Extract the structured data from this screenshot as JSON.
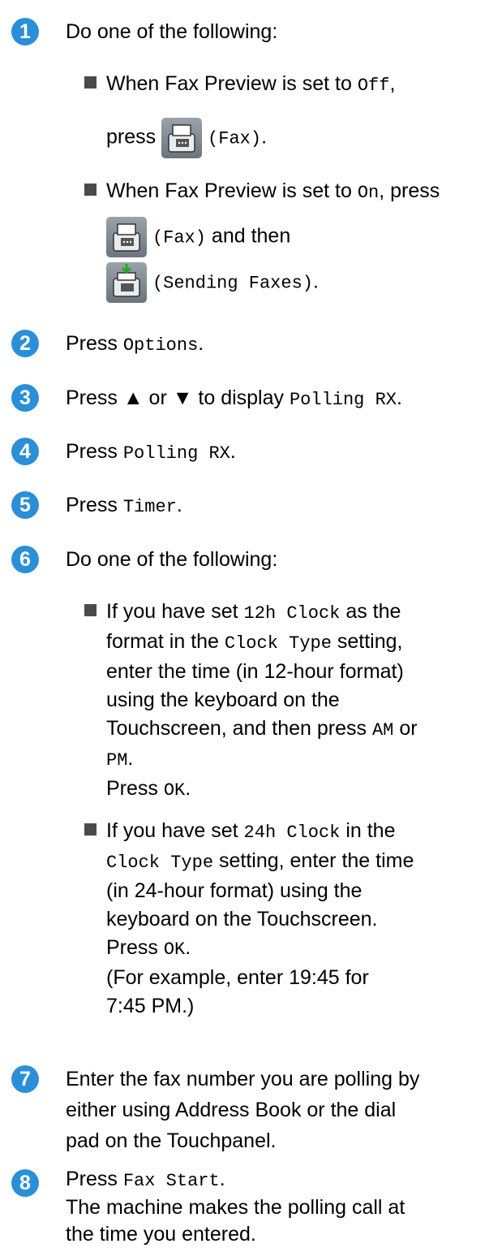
{
  "steps": [
    {
      "num": "1",
      "text": "Do one of the following:"
    },
    {
      "num": "2",
      "prefix": "Press ",
      "code": "Options",
      "suffix": "."
    },
    {
      "num": "3",
      "prefix": "Press ▲ or ▼ to display ",
      "code": "Polling RX",
      "suffix": "."
    },
    {
      "num": "4",
      "prefix": "Press ",
      "code": "Polling RX",
      "suffix": "."
    },
    {
      "num": "5",
      "prefix": "Press ",
      "code": "Timer",
      "suffix": "."
    },
    {
      "num": "6",
      "text": "Do one of the following:"
    },
    {
      "num": "7",
      "lines": [
        "Enter the fax number you are polling by",
        "either using Address Book or the dial",
        "pad on the Touchpanel."
      ]
    },
    {
      "num": "8",
      "prefix": "Press ",
      "code": "Fax Start",
      "suffix": ".",
      "lines": [
        "The machine makes the polling call at",
        "the time you entered."
      ]
    }
  ],
  "step1": {
    "b1": {
      "t1": "When Fax Preview is set to ",
      "c1": "Off",
      "t2": ",",
      "press": "press ",
      "icon": "fax-icon",
      "c2": "(Fax)",
      "t3": "."
    },
    "b2": {
      "t1": "When Fax Preview is set to ",
      "c1": "On",
      "t2": ", press",
      "icon1": "fax-icon",
      "c2": "(Fax)",
      "t3": " and then",
      "icon2": "sending-faxes-icon",
      "c3": "(Sending Faxes)",
      "t4": "."
    }
  },
  "step6": {
    "b1": {
      "t1": "If you have set ",
      "c1": "12h Clock",
      "t2": " as the",
      "t3": "format in the ",
      "c2": "Clock Type",
      "t4": " setting,",
      "l3": "enter the time (in 12-hour format)",
      "l4": "using the keyboard on the",
      "t5": "Touchscreen, and then press ",
      "c3": "AM",
      "t6": " or",
      "c4": "PM",
      "t7": ".",
      "t8": "Press ",
      "c5": "OK",
      "t9": "."
    },
    "b2": {
      "t1": "If you have set ",
      "c1": "24h Clock",
      "t2": " in the",
      "c2": "Clock Type",
      "t3": " setting, enter the time",
      "l3": "(in 24-hour format) using the",
      "l4": "keyboard on the Touchscreen.",
      "t4": "Press ",
      "c3": "OK",
      "t5": ".",
      "l6": "(For example, enter 19:45 for",
      "l7": "7:45 PM.)"
    }
  },
  "colors": {
    "step_circle": "#2a8fd6",
    "bullet": "#4a4a4a"
  }
}
